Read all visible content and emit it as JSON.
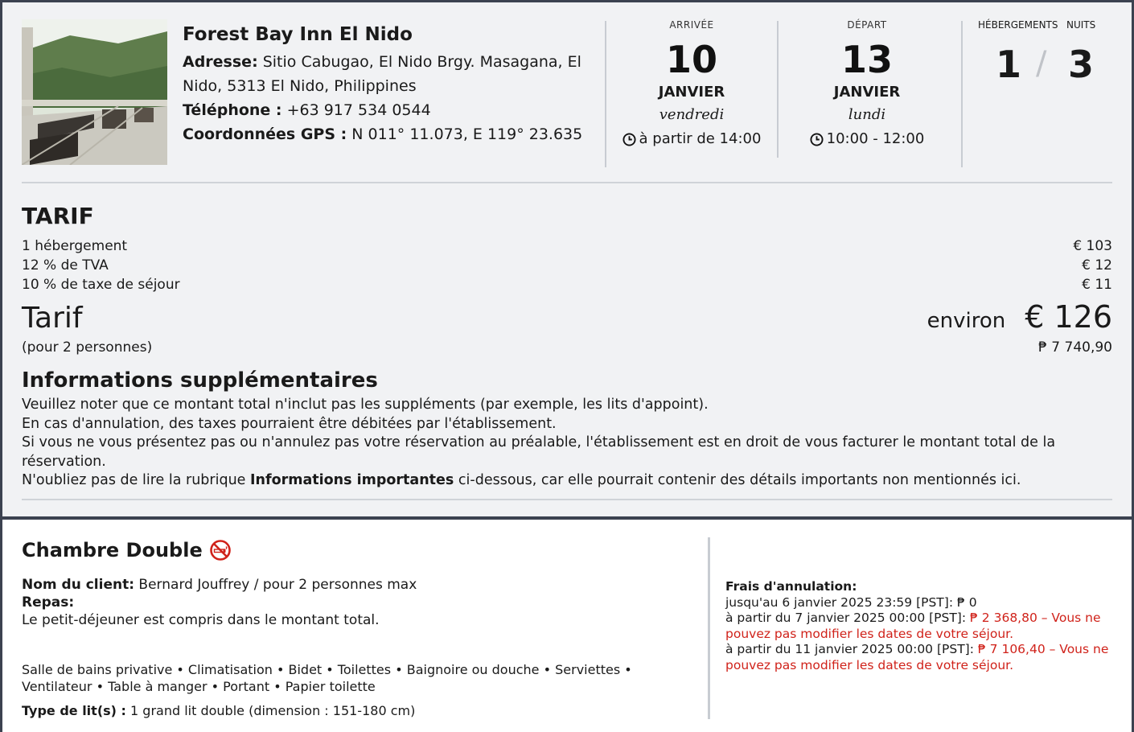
{
  "hotel": {
    "name": "Forest Bay Inn El Nido",
    "address_label": "Adresse:",
    "address": " Sitio Cabugao, El Nido Brgy. Masagana, El Nido, 5313 El Nido, Philippines",
    "phone_label": "Téléphone :",
    "phone": " +63 917 534 0544",
    "gps_label": "Coordonnées GPS :",
    "gps": " N 011° 11.073, E 119° 23.635"
  },
  "arrival": {
    "label": "ARRIVÉE",
    "day_num": "10",
    "month": "JANVIER",
    "weekday": "vendredi",
    "time": "à partir de 14:00"
  },
  "departure": {
    "label": "DÉPART",
    "day_num": "13",
    "month": "JANVIER",
    "weekday": "lundi",
    "time": "10:00 - 12:00"
  },
  "counts": {
    "rooms_label": "HÉBERGEMENTS",
    "nights_label": "NUITS",
    "rooms": "1",
    "slash": "/",
    "nights": "3"
  },
  "tarif": {
    "title": "TARIF",
    "rows": [
      {
        "label": "1 hébergement",
        "value": "€ 103"
      },
      {
        "label": "12 % de TVA",
        "value": "€ 12"
      },
      {
        "label": "10 % de taxe de séjour",
        "value": "€ 11"
      }
    ],
    "total_label": "Tarif",
    "approx_label": "environ",
    "total_amount": "€ 126",
    "persons_note": "(pour 2 personnes)",
    "total_php": "₱ 7 740,90"
  },
  "info": {
    "title": "Informations supplémentaires",
    "line1": "Veuillez noter que ce montant total n'inclut pas les suppléments (par exemple, les lits d'appoint).",
    "line2": "En cas d'annulation, des taxes pourraient être débitées par l'établissement.",
    "line3": "Si vous ne vous présentez pas ou n'annulez pas votre réservation au préalable, l'établissement est en droit de vous facturer le montant total de la réservation.",
    "line4_pre": "N'oubliez pas de lire la rubrique ",
    "line4_bold": "Informations importantes",
    "line4_post": " ci-dessous, car elle pourrait contenir des détails importants non mentionnés ici."
  },
  "room": {
    "title": "Chambre Double",
    "guest_label": "Nom du client:",
    "guest": " Bernard Jouffrey / pour 2 personnes max",
    "meals_label": "Repas:",
    "meals": "Le petit-déjeuner est compris dans le montant total.",
    "amenities": "Salle de bains privative • Climatisation • Bidet • Toilettes • Baignoire ou douche • Serviettes • Ventilateur • Table à manger • Portant • Papier toilette",
    "bed_label": "Type de lit(s) :",
    "bed": " 1 grand lit double (dimension : 151-180 cm)"
  },
  "cancellation": {
    "title": "Frais d'annulation:",
    "line1": "jusqu'au 6 janvier 2025 23:59 [PST]: ₱ 0",
    "line2_pre": "à partir du 7 janvier 2025 00:00 [PST]: ",
    "line2_red": "₱ 2 368,80 – Vous ne pouvez pas modifier les dates de votre séjour.",
    "line3_pre": "à partir du 11 janvier 2025 00:00 [PST]: ",
    "line3_red": "₱ 7 106,40 – Vous ne pouvez pas modifier les dates de votre séjour."
  },
  "colors": {
    "border": "#3c4250",
    "panel_bg": "#f1f2f4",
    "warning_red": "#d0221a"
  }
}
